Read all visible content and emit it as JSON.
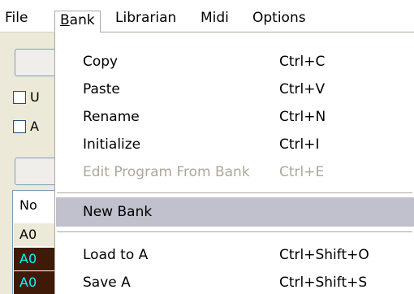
{
  "menubar": {
    "items": [
      {
        "label": "File"
      },
      {
        "label": "Bank",
        "mnemonic": "B",
        "rest": "ank"
      },
      {
        "label": "Librarian"
      },
      {
        "label": "Midi"
      },
      {
        "label": "Options"
      }
    ]
  },
  "background": {
    "checkbox_1_label": "U",
    "checkbox_2_label": "A",
    "list": {
      "header": "No",
      "rows": [
        "A0",
        "A0",
        "A0"
      ]
    }
  },
  "bank_menu": {
    "items": [
      {
        "label": "Copy",
        "shortcut": "Ctrl+C"
      },
      {
        "label": "Paste",
        "shortcut": "Ctrl+V"
      },
      {
        "label": "Rename",
        "shortcut": "Ctrl+N"
      },
      {
        "label": "Initialize",
        "shortcut": "Ctrl+I"
      },
      {
        "label": "Edit Program From Bank",
        "shortcut": "Ctrl+E",
        "disabled": true
      },
      {
        "label": "New Bank",
        "shortcut": "",
        "highlighted": true
      },
      {
        "label": "Load to A",
        "shortcut": "Ctrl+Shift+O"
      },
      {
        "label": "Save A",
        "shortcut": "Ctrl+Shift+S"
      }
    ]
  },
  "colors": {
    "menu_background": "#ffffff",
    "highlight": "#c1c0cd",
    "disabled_text": "#aca899",
    "window_background": "#ece9d8",
    "selected_row": "#3f1a08",
    "selected_row_text": "#00ffff"
  }
}
